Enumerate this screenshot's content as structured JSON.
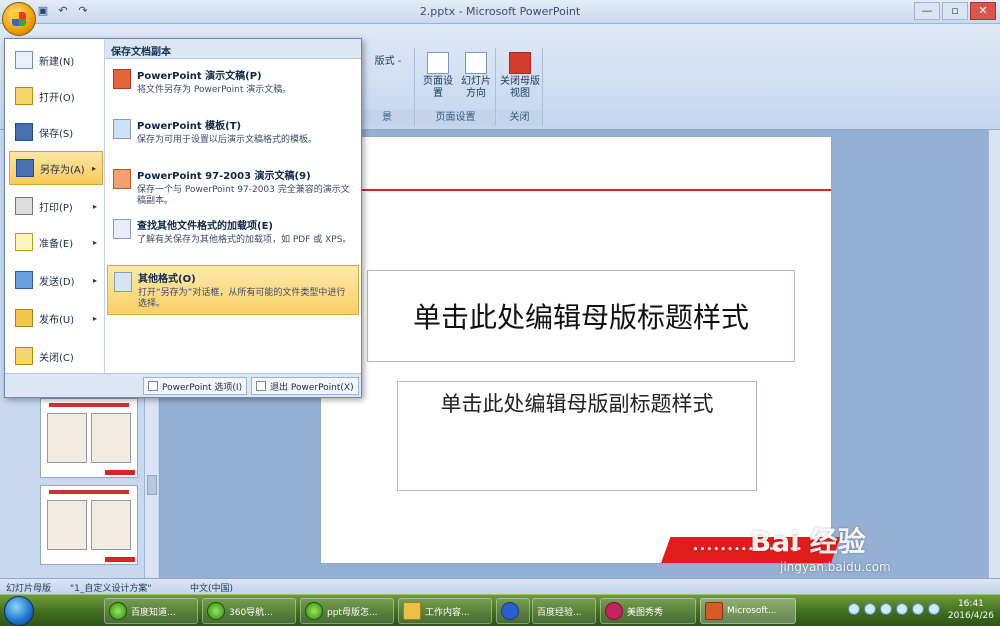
{
  "window": {
    "title": "2.pptx - Microsoft PowerPoint",
    "qat": [
      "save-icon",
      "undo-icon",
      "redo-icon"
    ],
    "controls": [
      "—",
      "▫",
      "✕"
    ]
  },
  "ribbon": {
    "tab_partial": "版式 -",
    "group_partial_label": "景 ",
    "groups": [
      {
        "label": "页面设置",
        "buttons": [
          {
            "label": "页面设置"
          },
          {
            "label": "幻灯片方向"
          }
        ]
      },
      {
        "label": "关闭",
        "buttons": [
          {
            "label": "关闭母版视图"
          }
        ]
      }
    ]
  },
  "office_menu": {
    "left_items": [
      {
        "label": "新建(N)",
        "icon": "new-document-icon",
        "has_arrow": false,
        "selected": false
      },
      {
        "label": "打开(O)",
        "icon": "open-folder-icon",
        "has_arrow": false,
        "selected": false
      },
      {
        "label": "保存(S)",
        "icon": "save-disk-icon",
        "has_arrow": false,
        "selected": false
      },
      {
        "label": "另存为(A)",
        "icon": "save-as-icon",
        "has_arrow": true,
        "selected": true
      },
      {
        "label": "打印(P)",
        "icon": "printer-icon",
        "has_arrow": true,
        "selected": false
      },
      {
        "label": "准备(E)",
        "icon": "prepare-icon",
        "has_arrow": true,
        "selected": false
      },
      {
        "label": "发送(D)",
        "icon": "send-icon",
        "has_arrow": true,
        "selected": false
      },
      {
        "label": "发布(U)",
        "icon": "publish-icon",
        "has_arrow": true,
        "selected": false
      },
      {
        "label": "关闭(C)",
        "icon": "close-folder-icon",
        "has_arrow": false,
        "selected": false
      }
    ],
    "right_header": "保存文档副本",
    "sub_items": [
      {
        "title": "PowerPoint 演示文稿(P)",
        "desc": "将文件另存为 PowerPoint 演示文稿。"
      },
      {
        "title": "PowerPoint 模板(T)",
        "desc": "保存为可用于设置以后演示文稿格式的模板。"
      },
      {
        "title": "PowerPoint 97-2003 演示文稿(9)",
        "desc": "保存一个与 PowerPoint 97-2003 完全兼容的演示文稿副本。"
      },
      {
        "title": "查找其他文件格式的加载项(E)",
        "desc": "了解有关保存为其他格式的加载项，如 PDF 或 XPS。"
      },
      {
        "title": "其他格式(O)",
        "desc": "打开“另存为”对话框，从所有可能的文件类型中进行选择。"
      }
    ],
    "footer": {
      "options": "PowerPoint 选项(I)",
      "exit": "退出 PowerPoint(X)"
    }
  },
  "slide": {
    "title_placeholder": "单击此处编辑母版标题样式",
    "subtitle_placeholder": "单击此处编辑母版副标题样式"
  },
  "statusbar": {
    "left": "幻灯片母版",
    "theme": "\"1_自定义设计方案\"",
    "lang": "中文(中国)"
  },
  "taskbar": {
    "items": [
      {
        "label": "百度知道...",
        "icon": "ie"
      },
      {
        "label": "360导航...",
        "icon": "ie"
      },
      {
        "label": "ppt母版怎...",
        "icon": "ie"
      },
      {
        "label": "工作内容...",
        "icon": "fol"
      },
      {
        "label": "",
        "icon": "paw"
      },
      {
        "label": "百度经验...",
        "icon": "paw"
      },
      {
        "label": "美图秀秀",
        "icon": "pin"
      },
      {
        "label": "Microsoft...",
        "icon": "ppt"
      }
    ],
    "time": "16:41",
    "date": "2016/4/26"
  },
  "watermark": {
    "brand": "Bai 经验",
    "url": "jingyan.baidu.com"
  }
}
